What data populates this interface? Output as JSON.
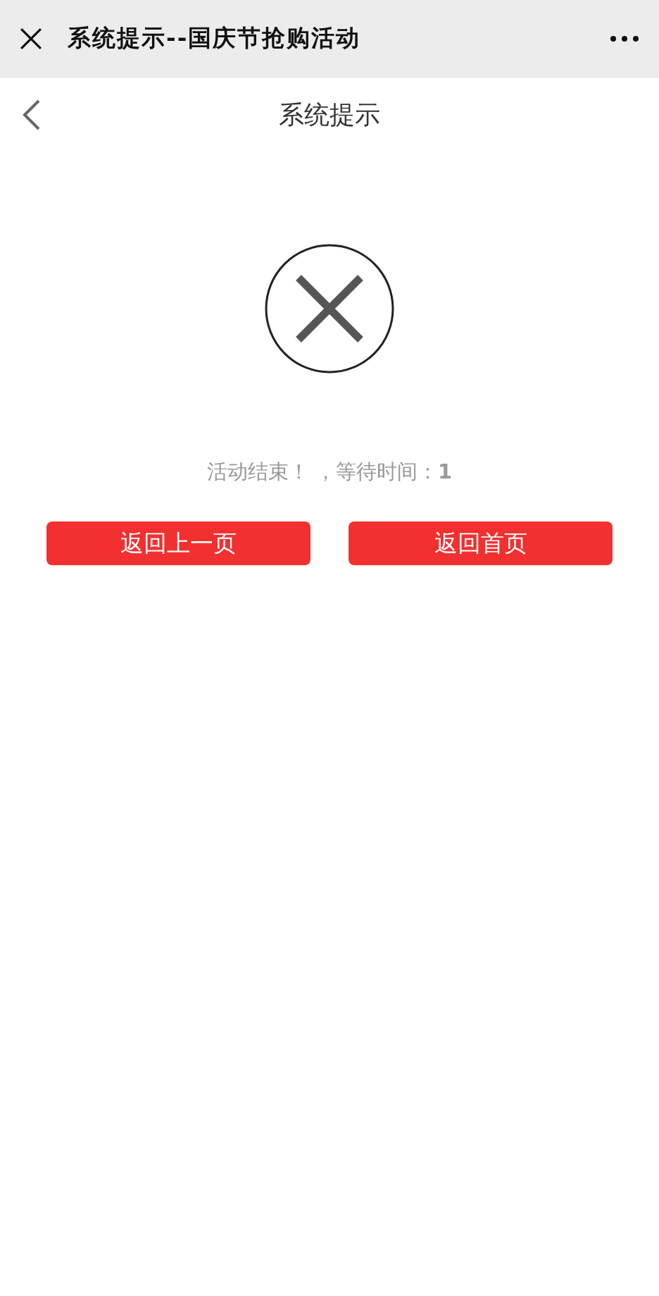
{
  "window": {
    "title": "系统提示--国庆节抢购活动"
  },
  "header": {
    "title": "系统提示"
  },
  "status": {
    "kind": "error",
    "message": "活动结束！ ，等待时间：**1**"
  },
  "buttons": [
    "返回上一页",
    "返回首页"
  ]
}
